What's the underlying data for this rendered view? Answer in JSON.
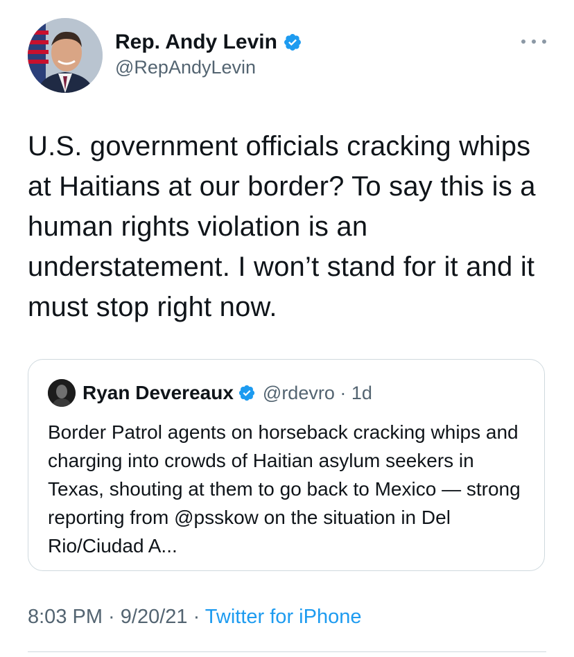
{
  "author": {
    "display_name": "Rep. Andy Levin",
    "handle": "@RepAndyLevin",
    "verified": true,
    "avatar_icon": "profile-photo"
  },
  "menu_icon": "more-options-icon",
  "tweet": {
    "text": "U.S. government officials cracking whips at Haitians at our border? To say this is a human rights violation is an understatement. I won’t stand for it and it must stop right now."
  },
  "quoted_tweet": {
    "display_name": "Ryan Devereaux",
    "handle": "@rdevro",
    "separator": " · ",
    "age": "1d",
    "verified": true,
    "text": "Border Patrol agents on horseback cracking whips and charging into crowds of Haitian asylum seekers in Texas, shouting at them to go back to Mexico — strong reporting from @psskow on the situation in Del Rio/Ciudad A..."
  },
  "footer": {
    "time": "8:03 PM",
    "sep1": " · ",
    "date": "9/20/21",
    "sep2": " · ",
    "source": "Twitter for iPhone"
  },
  "colors": {
    "verified_blue": "#1d9bf0",
    "secondary_text": "#536471",
    "primary_text": "#0f1419",
    "border": "#cfd9de"
  }
}
